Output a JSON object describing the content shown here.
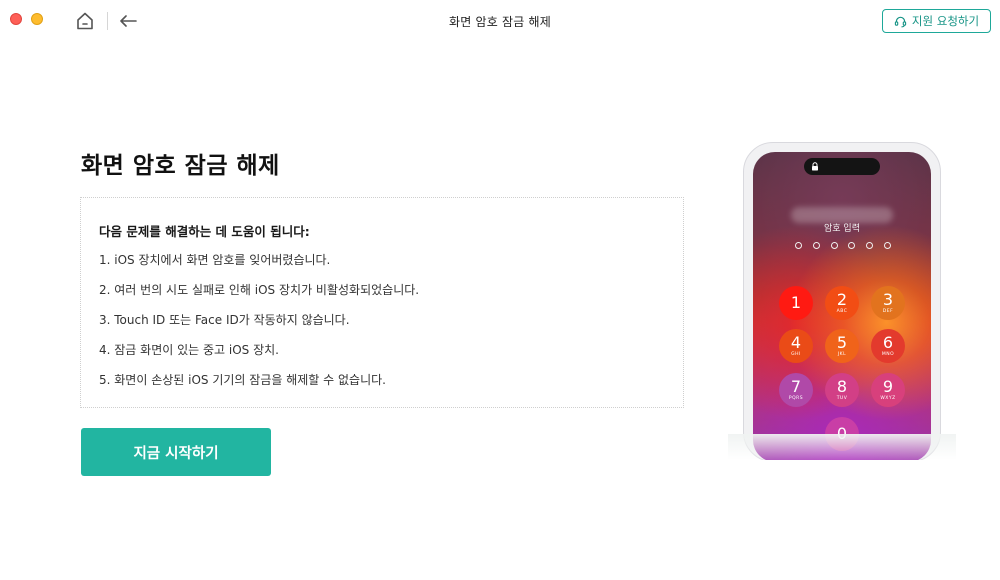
{
  "window": {
    "title": "화면 암호 잠금 해제",
    "support_label": "지원 요청하기"
  },
  "main": {
    "heading": "화면 암호 잠금 해제",
    "info_title": "다음 문제를 해결하는 데 도움이 됩니다:",
    "items": [
      "1. iOS 장치에서 화면 암호를 잊어버렸습니다.",
      "2. 여러 번의 시도 실패로 인해 iOS 장치가 비활성화되었습니다.",
      "3. Touch ID 또는 Face ID가 작동하지 않습니다.",
      "4. 잠금 화면이 있는 중고 iOS 장치.",
      "5. 화면이 손상된 iOS 기기의 잠금을 해제할 수 없습니다."
    ],
    "start_label": "지금 시작하기"
  },
  "phone": {
    "passcode_label": "암호 입력",
    "keys": [
      {
        "num": "1",
        "sub": ""
      },
      {
        "num": "2",
        "sub": "ABC"
      },
      {
        "num": "3",
        "sub": "DEF"
      },
      {
        "num": "4",
        "sub": "GHI"
      },
      {
        "num": "5",
        "sub": "JKL"
      },
      {
        "num": "6",
        "sub": "MNO"
      },
      {
        "num": "7",
        "sub": "PQRS"
      },
      {
        "num": "8",
        "sub": "TUV"
      },
      {
        "num": "9",
        "sub": "WXYZ"
      },
      {
        "num": "0",
        "sub": ""
      }
    ]
  },
  "colors": {
    "accent": "#22b5a1",
    "support_border": "#1ea899",
    "close": "#fe5f57",
    "minimize": "#febc2e"
  },
  "icons": {
    "home": "home-icon",
    "back": "back-arrow-icon",
    "support": "headset-icon",
    "lock": "lock-icon"
  }
}
